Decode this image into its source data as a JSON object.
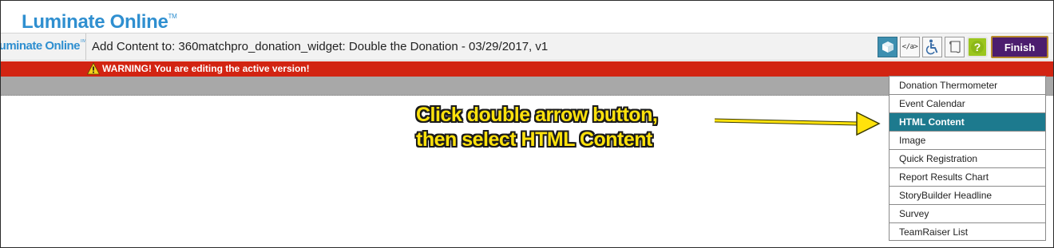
{
  "brand": {
    "name": "Luminate Online",
    "trademark": "TM",
    "color": "#2f8fd0"
  },
  "header": {
    "title": "Add Content to: 360matchpro_donation_widget: Double the Donation - 03/29/2017, v1",
    "toolbar": {
      "icons": [
        "cube-icon",
        "html-code-icon",
        "accessibility-icon",
        "page-icon",
        "help-icon"
      ],
      "code_label": "</a>",
      "help_label": "?",
      "finish_label": "Finish",
      "finish_color": "#4c1d6e"
    }
  },
  "warning": {
    "text": "WARNING! You are editing the active version!",
    "color": "#d22412"
  },
  "callout": {
    "line1": "Click double arrow button,",
    "line2": "then select HTML Content",
    "color": "#ffe20c"
  },
  "dropdown": {
    "selected": "HTML Content",
    "items": [
      "Donation Thermometer",
      "Event Calendar",
      "HTML Content",
      "Image",
      "Quick Registration",
      "Report Results Chart",
      "StoryBuilder Headline",
      "Survey",
      "TeamRaiser List"
    ],
    "highlight_color": "#1d7a8e"
  }
}
